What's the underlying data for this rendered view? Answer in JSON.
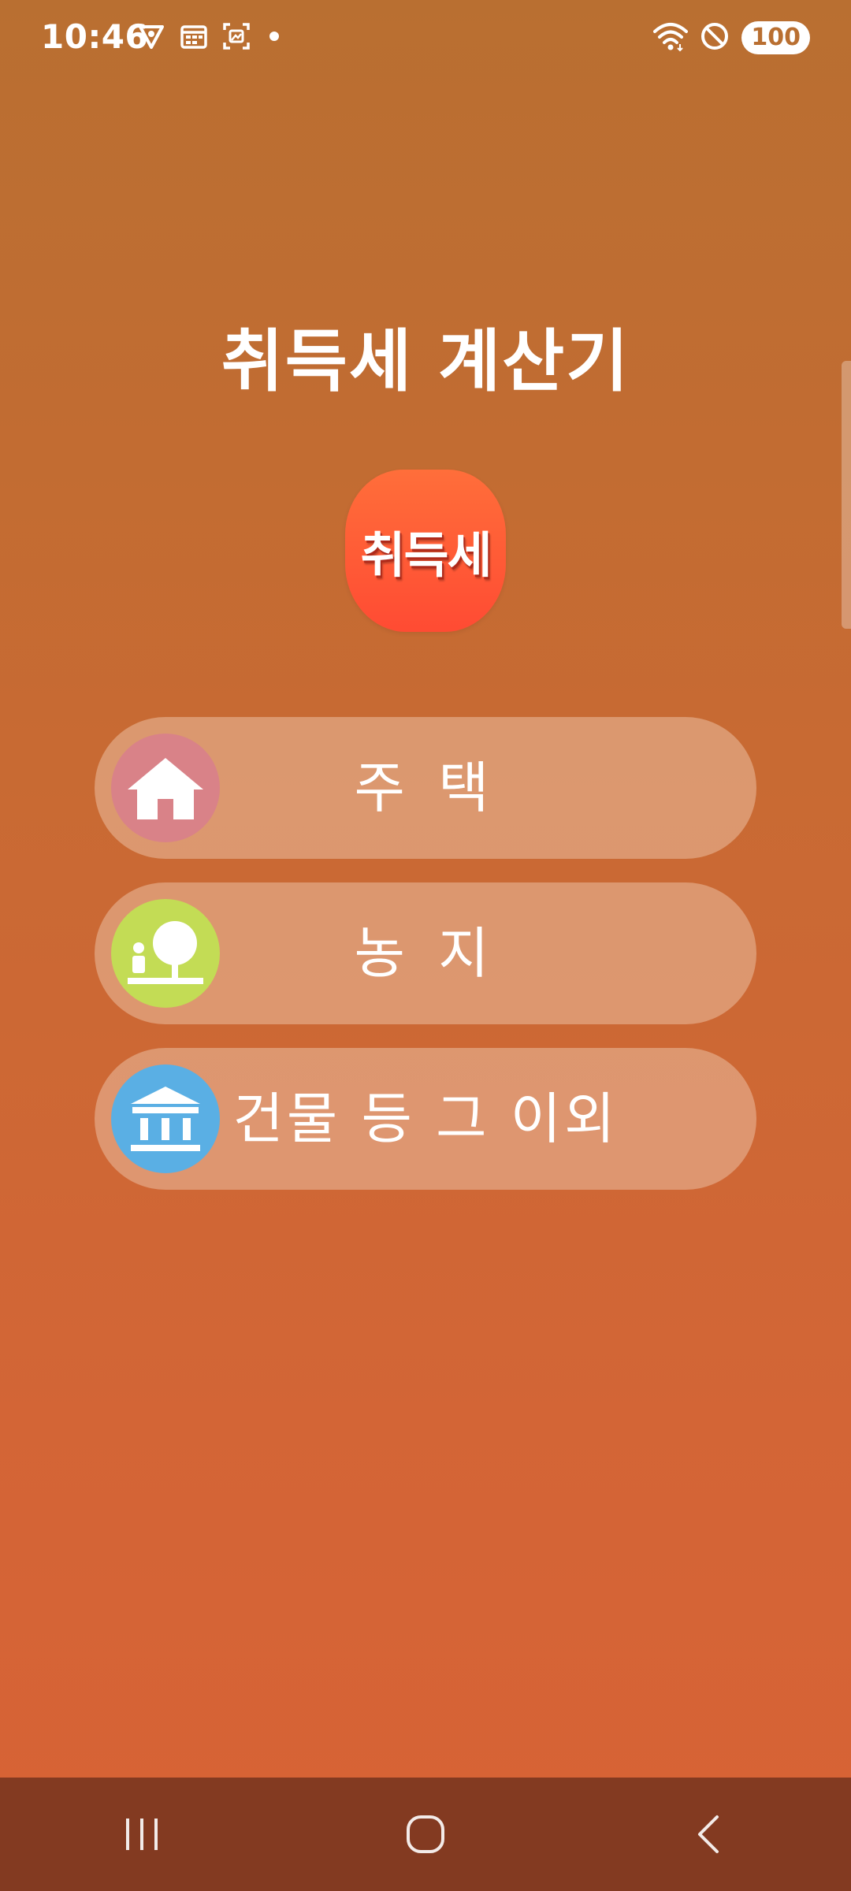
{
  "status_bar": {
    "time": "10:46",
    "battery": "100",
    "left_icons": [
      "vpn-shield-icon",
      "calendar-icon",
      "screenshot-icon",
      "notification-dot"
    ],
    "right_icons": [
      "wifi-icon",
      "do-not-disturb-icon",
      "battery-icon"
    ]
  },
  "app": {
    "title": "취득세 계산기",
    "logo_text": "취득세"
  },
  "menu": {
    "items": [
      {
        "label": "주 택",
        "icon": "house-icon",
        "color": "#d98288"
      },
      {
        "label": "농 지",
        "icon": "farmland-tree-icon",
        "color": "#c3dc55"
      },
      {
        "label": "건물 등 그 이외",
        "icon": "building-bank-icon",
        "color": "#5aafe4"
      }
    ]
  },
  "nav": {
    "buttons": [
      "recent-apps",
      "home",
      "back"
    ]
  },
  "colors": {
    "background_top": "#b96f31",
    "background_bottom": "#d86235",
    "nav_bar": "#833a21",
    "logo": "#ff5533"
  }
}
